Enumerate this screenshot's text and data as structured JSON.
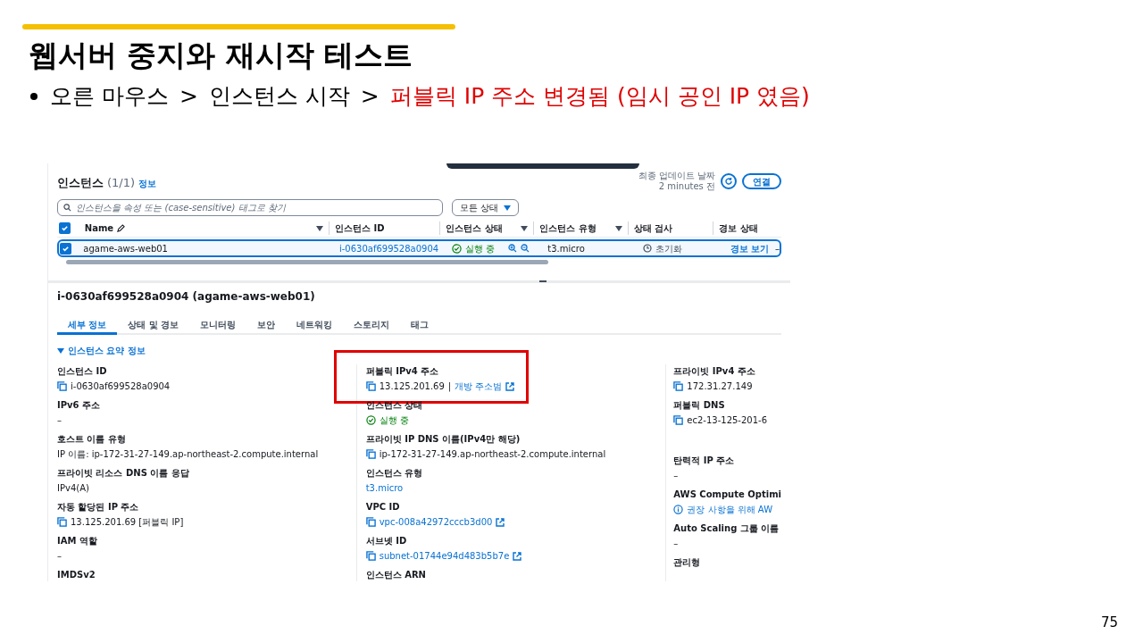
{
  "slide": {
    "title": "웹서버 중지와 재시작 테스트",
    "bullet": {
      "steps": [
        "오른 마우스",
        ">",
        "인스턴스 시작",
        ">"
      ],
      "highlight": "퍼블릭 IP 주소 변경됨  (임시 공인 IP 였음)"
    },
    "page_number": "75"
  },
  "console": {
    "list": {
      "title": "인스턴스",
      "count": "(1/1)",
      "info": "정보",
      "updated_label": "최종 업데이트 날짜",
      "updated_time": "2 minutes 전",
      "connect_button": "연결",
      "search": {
        "placeholder": "인스턴스을 속성 또는 (case-sensitive) 태그로 찾기"
      },
      "filter": "모든 상태",
      "all_checked": true,
      "columns": [
        "Name",
        "인스턴스 ID",
        "인스턴스 상태",
        "인스턴스 유형",
        "상태 검사",
        "경보 상태"
      ],
      "rows": [
        {
          "selected": true,
          "name": "agame-aws-web01",
          "id": "i-0630af699528a0904",
          "state": "실행 중",
          "type": "t3.micro",
          "check": "초기화",
          "alarm": "경보 보기",
          "column_7": "–"
        }
      ]
    },
    "detail": {
      "title": "i-0630af699528a0904 (agame-aws-web01)",
      "tabs": [
        {
          "label": "세부 정보",
          "selected": true
        },
        {
          "label": "상태 및 경보",
          "selected": false
        },
        {
          "label": "모니터링",
          "selected": false
        },
        {
          "label": "보안",
          "selected": false
        },
        {
          "label": "네트워킹",
          "selected": false
        },
        {
          "label": "스토리지",
          "selected": false
        },
        {
          "label": "태그",
          "selected": false
        }
      ],
      "section": {
        "title": "인스턴스 요약",
        "info": "정보",
        "expanded": true
      },
      "columns": [
        [
          {
            "label": "인스턴스 ID",
            "value": "i-0630af699528a0904",
            "kind": "copy"
          },
          {
            "label": "IPv6 주소",
            "value": "–",
            "kind": "plain"
          },
          {
            "label": "호스트 이름 유형",
            "value": "IP 이름: ip-172-31-27-149.ap-northeast-2.compute.internal",
            "kind": "plain"
          },
          {
            "label": "프라이빗 리소스 DNS 이름 응답",
            "value": "IPv4(A)",
            "kind": "plain"
          },
          {
            "label": "자동 할당된 IP 주소",
            "value": "13.125.201.69 [퍼블릭 IP]",
            "kind": "copy"
          },
          {
            "label": "IAM 역할",
            "value": "–",
            "kind": "plain"
          },
          {
            "label": "IMDSv2",
            "kind": "label"
          }
        ],
        [
          {
            "label": "퍼블릭 IPv4 주소",
            "value": "13.125.201.69",
            "separator": "|",
            "link": "개방 주소범",
            "kind": "copy_link",
            "highlighted": true
          },
          {
            "label": "인스턴스 상태",
            "value": "실행 중",
            "kind": "status"
          },
          {
            "label": "프라이빗 IP DNS 이름(IPv4만 해당)",
            "value": "ip-172-31-27-149.ap-northeast-2.compute.internal",
            "kind": "copy"
          },
          {
            "label": "인스턴스 유형",
            "value": "t3.micro",
            "kind": "link"
          },
          {
            "label": "VPC ID",
            "value": "vpc-008a42972cccb3d00",
            "kind": "copy_external"
          },
          {
            "label": "서브넷 ID",
            "value": "subnet-01744e94d483b5b7e",
            "kind": "copy_external"
          },
          {
            "label": "인스턴스 ARN",
            "kind": "label"
          }
        ],
        [
          {
            "label": "프라이빗 IPv4 주소",
            "value": "172.31.27.149",
            "kind": "copy"
          },
          {
            "label": "퍼블릭 DNS",
            "value": "ec2-13-125-201-6",
            "kind": "copy"
          },
          {
            "label": "탄력적 IP 주소",
            "value": "–",
            "kind": "plain",
            "spaced": true
          },
          {
            "label": "AWS Compute Optimi",
            "value": "권장 사항을 위해 AW",
            "kind": "info"
          },
          {
            "label": "Auto Scaling 그룹 이름",
            "value": "–",
            "kind": "plain"
          },
          {
            "label": "관리형",
            "kind": "label"
          }
        ]
      ]
    }
  }
}
